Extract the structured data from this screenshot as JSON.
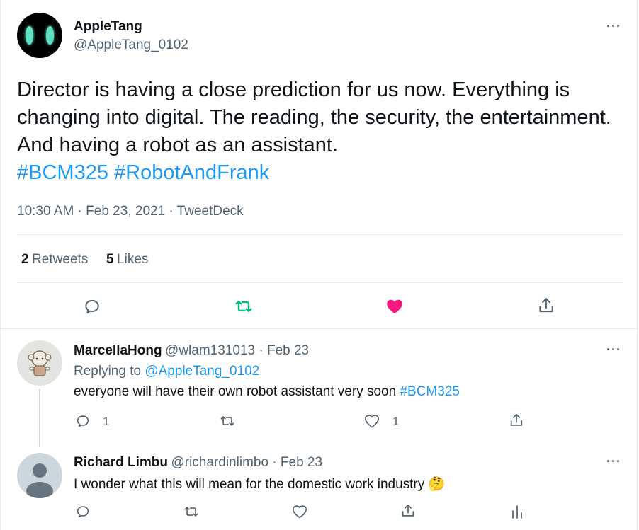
{
  "tweet": {
    "author_name": "AppleTang",
    "author_handle": "@AppleTang_0102",
    "text": "Director is having a close prediction for us now. Everything is changing into digital. The reading, the security, the entertainment. And having a robot as an assistant.",
    "hashtag_1": "#BCM325",
    "hashtag_2": "#RobotAndFrank",
    "timestamp": "10:30 AM · Feb 23, 2021 · TweetDeck",
    "retweets_count": "2",
    "retweets_label": "Retweets",
    "likes_count": "5",
    "likes_label": "Likes",
    "more_label": "···"
  },
  "replies": [
    {
      "name": "MarcellaHong",
      "handle_time": "@wlam131013 · Feb 23",
      "replying_prefix": "Replying to",
      "replying_to": "@AppleTang_0102",
      "text": "everyone will have their own robot assistant very soon",
      "hashtag": "#BCM325",
      "reply_count": "1",
      "like_count": "1",
      "more_label": "···"
    },
    {
      "name": "Richard Limbu",
      "handle_time": "@richardinlimbo · Feb 23",
      "text": "I wonder what this will mean for the domestic work industry",
      "emoji": "🤔",
      "more_label": "···"
    }
  ],
  "colors": {
    "accent": "#1d9bf0",
    "retweet_active": "#00ba7c",
    "like_active": "#f91880",
    "muted": "#536471"
  }
}
